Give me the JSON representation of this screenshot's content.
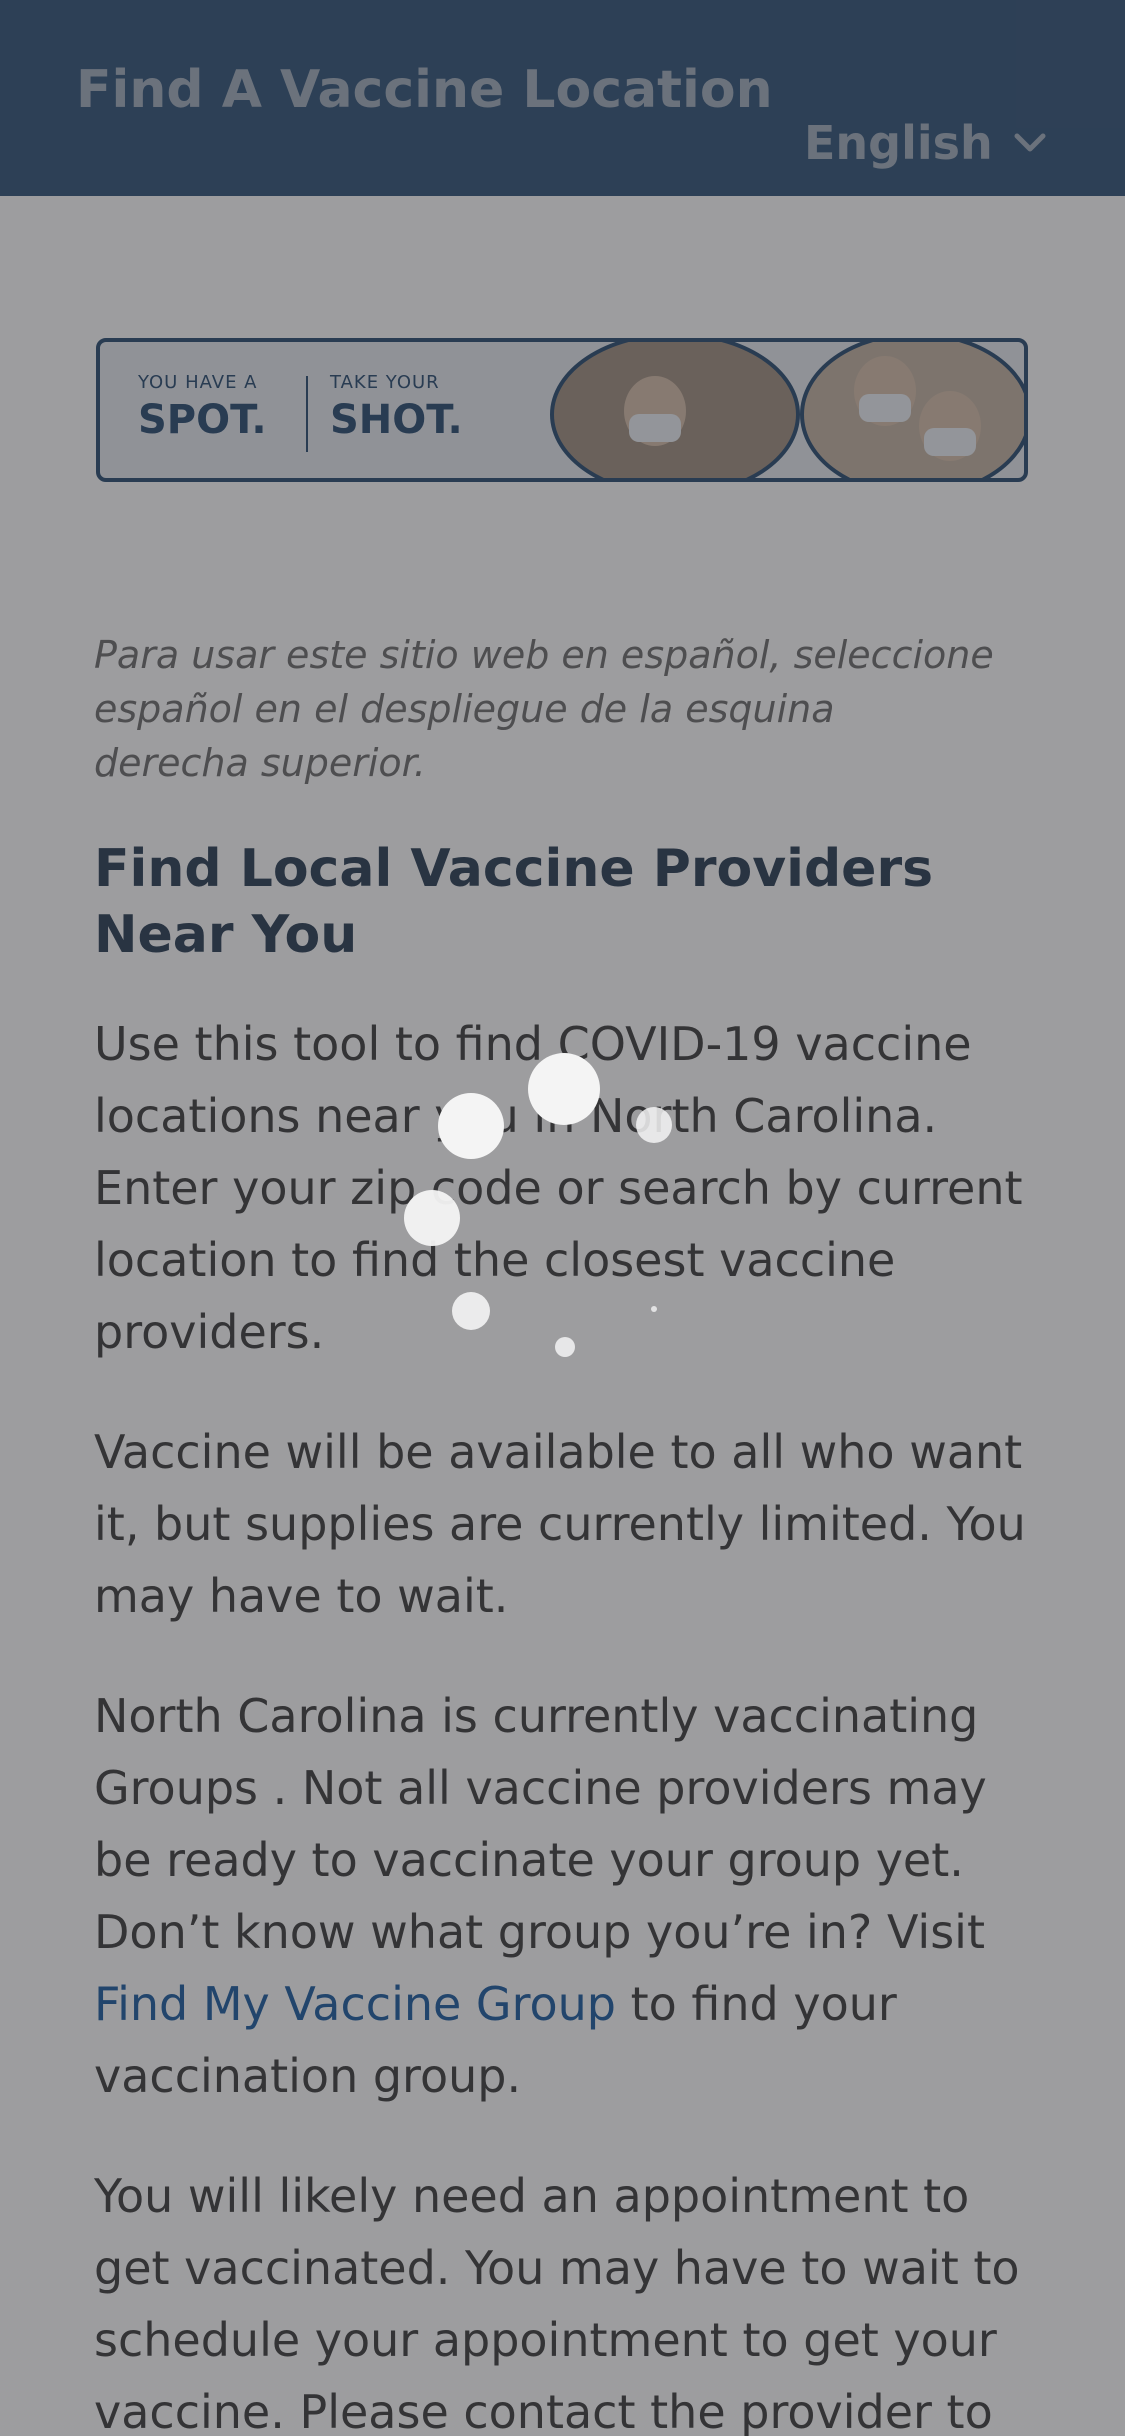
{
  "header": {
    "title": "Find A Vaccine Location",
    "language": "English"
  },
  "banner": {
    "part1_small": "YOU HAVE A",
    "part1_big": "SPOT.",
    "part2_small": "TAKE YOUR",
    "part2_big": "SHOT."
  },
  "content": {
    "spanish_note": "Para usar este sitio web en español, seleccione español en el despliegue de la esquina derecha superior.",
    "heading": "Find Local Vaccine Providers Near You",
    "para1": "Use this tool to find COVID-19 vaccine locations near you in North Carolina. Enter your zip code or search by current location to find the closest vaccine providers.",
    "para2": "Vaccine will be available to all who want it, but supplies are currently limited. You may have to wait.",
    "para3_before_link": "North Carolina is currently vaccinating Groups . Not all vaccine providers may be ready to vaccinate your group yet. Don’t know what group you’re in? Visit ",
    "para3_link": "Find My Vaccine Group",
    "para3_after_link": " to find your vaccination group.",
    "para4": "You will likely need an appointment to get vaccinated. You may have to wait to schedule your appointment to get your vaccine. Please contact the provider to"
  },
  "colors": {
    "header_bg": "#3f5f82",
    "link": "#2b68a8",
    "heading": "#384a60"
  },
  "icons": {
    "language_dropdown": "chevron-down-icon",
    "loading": "loading-spinner-icon"
  }
}
